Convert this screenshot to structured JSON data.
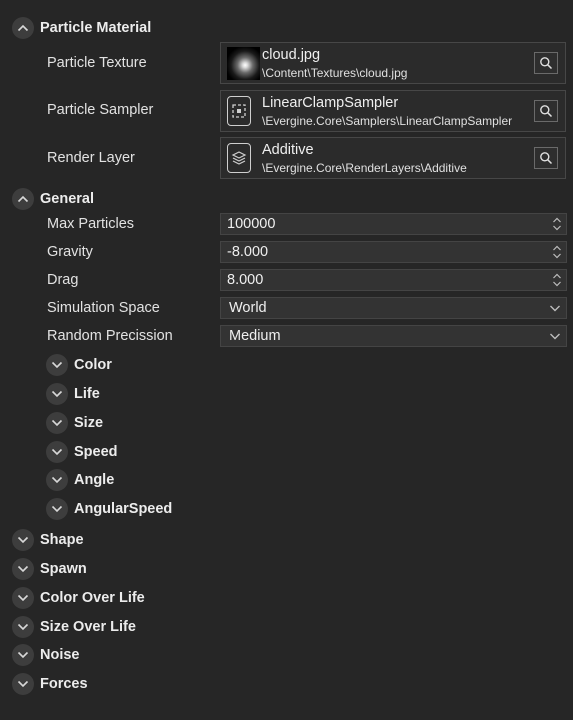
{
  "particle_material": {
    "title": "Particle Material",
    "texture": {
      "label": "Particle Texture",
      "name": "cloud.jpg",
      "path": "\\Content\\Textures\\cloud.jpg"
    },
    "sampler": {
      "label": "Particle Sampler",
      "name": "LinearClampSampler",
      "path": "\\Evergine.Core\\Samplers\\LinearClampSampler"
    },
    "render_layer": {
      "label": "Render Layer",
      "name": "Additive",
      "path": "\\Evergine.Core\\RenderLayers\\Additive"
    }
  },
  "general": {
    "title": "General",
    "max_particles": {
      "label": "Max Particles",
      "value": "100000"
    },
    "gravity": {
      "label": "Gravity",
      "value": "-8.000"
    },
    "drag": {
      "label": "Drag",
      "value": "8.000"
    },
    "simulation_space": {
      "label": "Simulation Space",
      "value": "World"
    },
    "random_precission": {
      "label": "Random Precission",
      "value": "Medium"
    },
    "subsections": [
      "Color",
      "Life",
      "Size",
      "Speed",
      "Angle",
      "AngularSpeed"
    ]
  },
  "sections": [
    "Shape",
    "Spawn",
    "Color Over Life",
    "Size Over Life",
    "Noise",
    "Forces"
  ],
  "icons": {
    "expanded": "chevron-up-icon",
    "collapsed": "chevron-down-icon",
    "search": "search-icon",
    "sampler": "sampler-asset-icon",
    "render_layer": "layers-icon"
  },
  "colors": {
    "background": "#262626",
    "field": "#333333",
    "text": "#e2e2e2"
  }
}
